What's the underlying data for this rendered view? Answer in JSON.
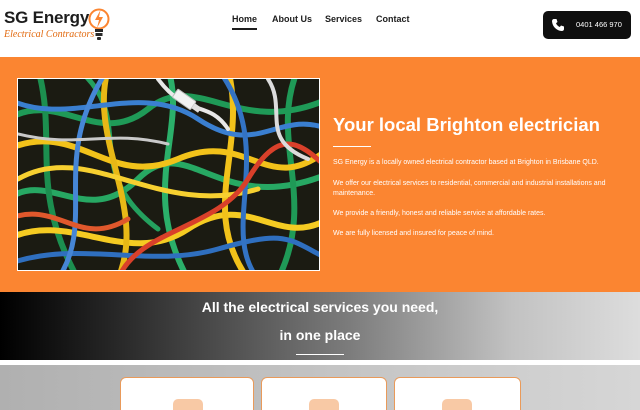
{
  "brand": {
    "name": "SG Energy",
    "tagline": "Electrical Contractors"
  },
  "nav": {
    "items": [
      {
        "label": "Home",
        "active": true
      },
      {
        "label": "About Us",
        "active": false
      },
      {
        "label": "Services",
        "active": false
      },
      {
        "label": "Contact",
        "active": false
      }
    ]
  },
  "phone": {
    "number": "0401 466 970",
    "icon": "phone-icon"
  },
  "hero": {
    "image_icon": "electrical-cables-photo",
    "title": "Your local Brighton electrician",
    "paragraphs": [
      "SG Energy is a locally owned electrical contractor based at Brighton in Brisbane QLD.",
      "We offer our electrical services to residential, commercial and industrial installations and maintenance.",
      "We provide a friendly, honest and reliable service at affordable rates.",
      "We are fully licensed and insured for peace of mind."
    ]
  },
  "services_banner": {
    "line1": "All the electrical services you need,",
    "line2": "in one place"
  },
  "colors": {
    "accent": "#fb8531",
    "dark": "#0f0f0f",
    "card_border": "#e99a5a",
    "card_icon_bg": "#f8c9a5"
  }
}
